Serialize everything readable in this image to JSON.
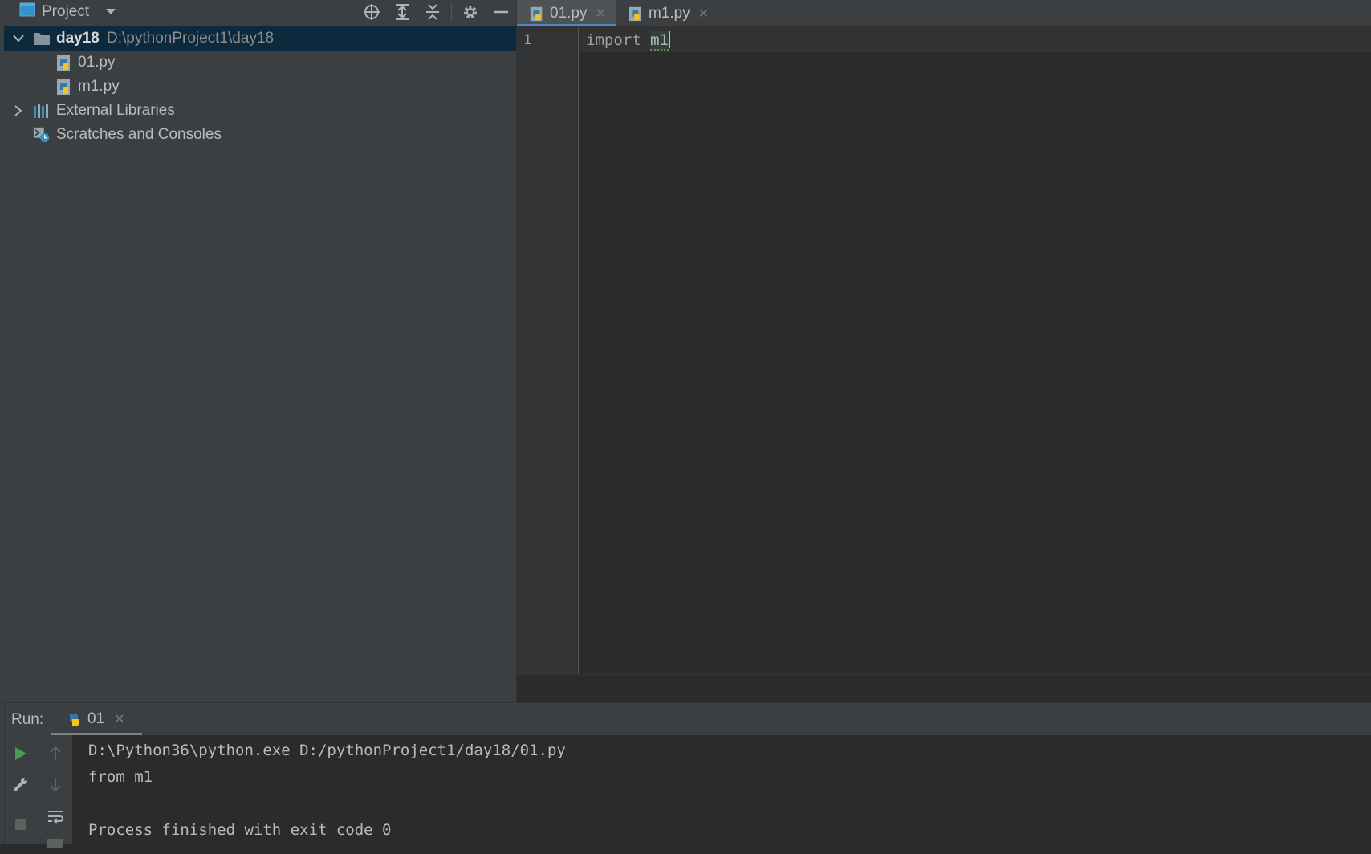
{
  "project_panel": {
    "title": "Project",
    "tree": {
      "root": {
        "name": "day18",
        "path": "D:\\pythonProject1\\day18"
      },
      "files": [
        "01.py",
        "m1.py"
      ],
      "external_libraries": "External Libraries",
      "scratches": "Scratches and Consoles"
    }
  },
  "editor": {
    "tabs": [
      {
        "label": "01.py",
        "active": true
      },
      {
        "label": "m1.py",
        "active": false
      }
    ],
    "line_number": "1",
    "code": {
      "keyword": "import",
      "module": "m1"
    }
  },
  "run": {
    "label": "Run:",
    "tab_label": "01",
    "console_lines": [
      "D:\\Python36\\python.exe D:/pythonProject1/day18/01.py",
      "from m1",
      "",
      "Process finished with exit code 0"
    ]
  },
  "colors": {
    "panel_bg": "#3c3f41",
    "editor_bg": "#2b2b2b",
    "selection": "#0d293e",
    "tab_accent": "#4a88c7",
    "run_green": "#499c54"
  }
}
